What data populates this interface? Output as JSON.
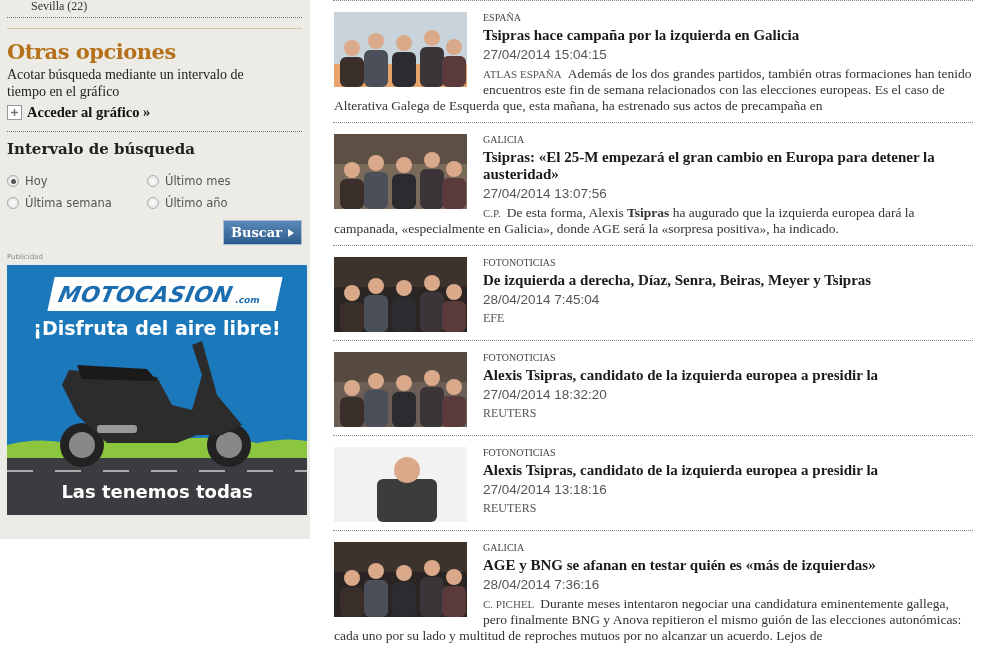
{
  "sidebar": {
    "filter_item": "Sevilla  (22)",
    "options_title": "Otras opciones",
    "options_text": "Acotar búsqueda mediante un intervalo de tiempo en el gráfico",
    "chart_link": "Acceder al gráfico »",
    "interval_title": "Intervalo de búsqueda",
    "intervals": [
      {
        "label": "Hoy",
        "selected": true
      },
      {
        "label": "Último mes",
        "selected": false
      },
      {
        "label": "Última semana",
        "selected": false
      },
      {
        "label": "Último año",
        "selected": false
      }
    ],
    "search_button": "Buscar",
    "ad_label": "Publicidad",
    "ad": {
      "brand": "MOTOCASION",
      ".com": ".com",
      "slogan": "¡Disfruta del aire libre!",
      "tagline": "Las tenemos todas"
    }
  },
  "articles": [
    {
      "section": "ESPAÑA",
      "title": "Tsipras hace campaña por la izquierda en Galicia",
      "date": "27/04/2014 15:04:15",
      "author": "ATLAS ESPAÑA",
      "summary": "Además de los dos grandes partidos, también otras formaciones han tenido encuentros este fin de semana relacionados con las elecciones europeas. Es el caso de Alterativa Galega de Esquerda que, esta mañana, ha estrenado sus actos de precampaña en"
    },
    {
      "section": "GALICIA",
      "title": "Tsipras: «El 25-M empezará el gran cambio en Europa para detener la austeridad»",
      "date": "27/04/2014 13:07:56",
      "author": "C.P.",
      "summary": "De esta forma, Alexis **Tsipras** ha augurado que la izquierda europea dará la campanada, «especialmente en Galicia», donde AGE será la «sorpresa positiva», ha indicado."
    },
    {
      "section": "FOTONOTICIAS",
      "title": "De izquierda a derecha, Díaz, Senra, Beiras, Meyer y Tsipras",
      "date": "28/04/2014 7:45:04",
      "author": "EFE"
    },
    {
      "section": "FOTONOTICIAS",
      "title": "Alexis Tsipras, candidato de la izquierda europea a presidir la",
      "date": "27/04/2014 18:32:20",
      "author": "REUTERS"
    },
    {
      "section": "FOTONOTICIAS",
      "title": "Alexis Tsipras, candidato de la izquierda europea a presidir la",
      "date": "27/04/2014 13:18:16",
      "author": "REUTERS"
    },
    {
      "section": "GALICIA",
      "title": "AGE y BNG se afanan en testar quién es «más de izquierdas»",
      "date": "28/04/2014 7:36:16",
      "author": "C. PICHEL",
      "summary": "Durante meses intentaron negociar una candidatura eminentemente gallega, pero finalmente BNG y Anova repitieron el mismo guión de las elecciones autonómicas: cada uno por su lado y multitud de reproches mutuos por no alcanzar un acuerdo. Lejos de"
    }
  ]
}
